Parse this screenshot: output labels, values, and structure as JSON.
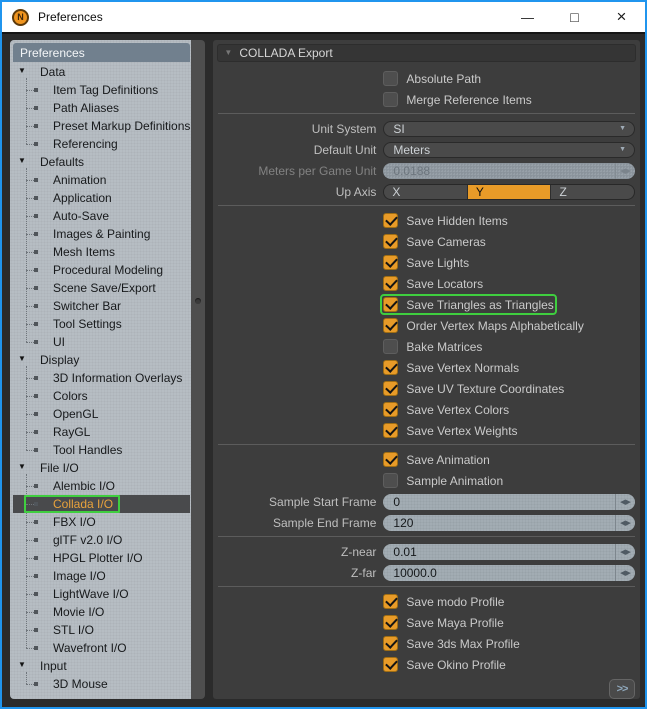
{
  "colors": {
    "accent_orange": "#E89B28",
    "highlight_green": "#3FCE3F",
    "selected_item_text": "#E8A23C",
    "window_border": "#2095EE"
  },
  "window": {
    "title": "Preferences",
    "controls": {
      "minimize": "—",
      "maximize": "□",
      "close": "×"
    }
  },
  "sidebar": {
    "header": "Preferences",
    "items": [
      {
        "type": "section",
        "label": "Data"
      },
      {
        "type": "leaf",
        "label": "Item Tag Definitions"
      },
      {
        "type": "leaf",
        "label": "Path Aliases"
      },
      {
        "type": "leaf",
        "label": "Preset Markup Definitions"
      },
      {
        "type": "leaf",
        "label": "Referencing"
      },
      {
        "type": "section",
        "label": "Defaults"
      },
      {
        "type": "leaf",
        "label": "Animation"
      },
      {
        "type": "leaf",
        "label": "Application"
      },
      {
        "type": "leaf",
        "label": "Auto-Save"
      },
      {
        "type": "leaf",
        "label": "Images & Painting"
      },
      {
        "type": "leaf",
        "label": "Mesh Items"
      },
      {
        "type": "leaf",
        "label": "Procedural Modeling"
      },
      {
        "type": "leaf",
        "label": "Scene Save/Export"
      },
      {
        "type": "leaf",
        "label": "Switcher Bar"
      },
      {
        "type": "leaf",
        "label": "Tool Settings"
      },
      {
        "type": "leaf",
        "label": "UI"
      },
      {
        "type": "section",
        "label": "Display"
      },
      {
        "type": "leaf",
        "label": "3D Information Overlays"
      },
      {
        "type": "leaf",
        "label": "Colors"
      },
      {
        "type": "leaf",
        "label": "OpenGL"
      },
      {
        "type": "leaf",
        "label": "RayGL"
      },
      {
        "type": "leaf",
        "label": "Tool Handles"
      },
      {
        "type": "section",
        "label": "File I/O"
      },
      {
        "type": "leaf",
        "label": "Alembic I/O"
      },
      {
        "type": "leaf",
        "label": "Collada I/O",
        "selected": true,
        "highlighted": true
      },
      {
        "type": "leaf",
        "label": "FBX I/O"
      },
      {
        "type": "leaf",
        "label": "glTF v2.0 I/O"
      },
      {
        "type": "leaf",
        "label": "HPGL Plotter I/O"
      },
      {
        "type": "leaf",
        "label": "Image I/O"
      },
      {
        "type": "leaf",
        "label": "LightWave I/O"
      },
      {
        "type": "leaf",
        "label": "Movie I/O"
      },
      {
        "type": "leaf",
        "label": "STL I/O"
      },
      {
        "type": "leaf",
        "label": "Wavefront I/O"
      },
      {
        "type": "section",
        "label": "Input"
      },
      {
        "type": "leaf",
        "label": "3D Mouse"
      }
    ]
  },
  "panel": {
    "header": "COLLADA Export",
    "more_button": ">>",
    "rows": [
      {
        "t": "checkbox",
        "label": "Absolute Path",
        "checked": false
      },
      {
        "t": "checkbox",
        "label": "Merge Reference Items",
        "checked": false
      },
      {
        "t": "divider"
      },
      {
        "t": "select",
        "label": "Unit System",
        "value": "SI"
      },
      {
        "t": "select",
        "label": "Default Unit",
        "value": "Meters"
      },
      {
        "t": "number",
        "label": "Meters per Game Unit",
        "value": "0.0188",
        "disabled": true
      },
      {
        "t": "segmented",
        "label": "Up Axis",
        "options": [
          "X",
          "Y",
          "Z"
        ],
        "selected": "Y"
      },
      {
        "t": "divider"
      },
      {
        "t": "checkbox",
        "label": "Save Hidden Items",
        "checked": true
      },
      {
        "t": "checkbox",
        "label": "Save Cameras",
        "checked": true
      },
      {
        "t": "checkbox",
        "label": "Save Lights",
        "checked": true
      },
      {
        "t": "checkbox",
        "label": "Save Locators",
        "checked": true
      },
      {
        "t": "checkbox",
        "label": "Save Triangles as Triangles",
        "checked": true,
        "highlighted": true
      },
      {
        "t": "checkbox",
        "label": "Order Vertex Maps Alphabetically",
        "checked": true
      },
      {
        "t": "checkbox",
        "label": "Bake Matrices",
        "checked": false
      },
      {
        "t": "checkbox",
        "label": "Save Vertex Normals",
        "checked": true
      },
      {
        "t": "checkbox",
        "label": "Save UV Texture Coordinates",
        "checked": true
      },
      {
        "t": "checkbox",
        "label": "Save Vertex Colors",
        "checked": true
      },
      {
        "t": "checkbox",
        "label": "Save Vertex Weights",
        "checked": true
      },
      {
        "t": "divider"
      },
      {
        "t": "checkbox",
        "label": "Save Animation",
        "checked": true
      },
      {
        "t": "checkbox",
        "label": "Sample Animation",
        "checked": false
      },
      {
        "t": "number",
        "label": "Sample Start Frame",
        "value": "0"
      },
      {
        "t": "number",
        "label": "Sample End Frame",
        "value": "120"
      },
      {
        "t": "divider"
      },
      {
        "t": "number",
        "label": "Z-near",
        "value": "0.01"
      },
      {
        "t": "number",
        "label": "Z-far",
        "value": "10000.0"
      },
      {
        "t": "divider"
      },
      {
        "t": "checkbox",
        "label": "Save modo Profile",
        "checked": true
      },
      {
        "t": "checkbox",
        "label": "Save Maya Profile",
        "checked": true
      },
      {
        "t": "checkbox",
        "label": "Save 3ds Max Profile",
        "checked": true
      },
      {
        "t": "checkbox",
        "label": "Save Okino Profile",
        "checked": true
      }
    ]
  }
}
